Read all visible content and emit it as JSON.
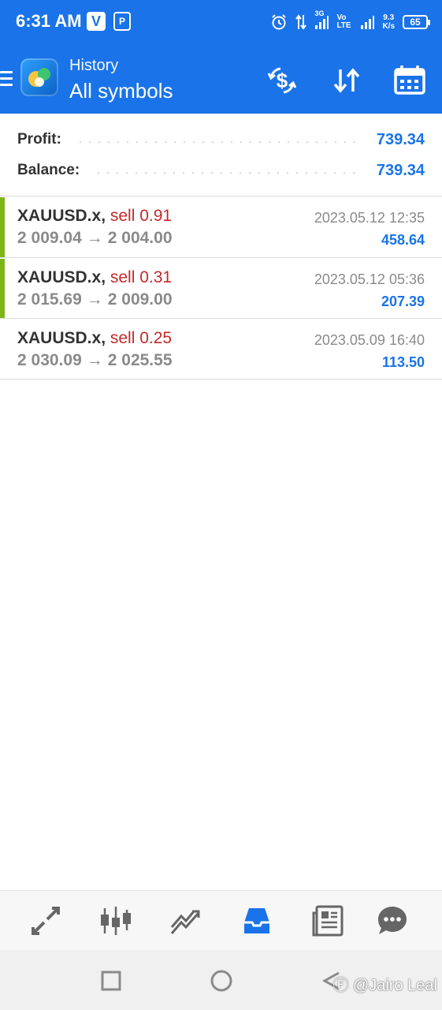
{
  "status_bar": {
    "time": "6:31 AM",
    "net_3g": "3G",
    "volte": "Vo LTE",
    "net_speed_value": "9.3",
    "net_speed_unit": "K/s",
    "battery": "65"
  },
  "app_bar": {
    "title_small": "History",
    "title_big": "All symbols",
    "icons": [
      "menu-icon",
      "metatrader-logo",
      "dollar-refresh-icon",
      "sort-icon",
      "calendar-icon"
    ]
  },
  "summary": {
    "profit_label": "Profit:",
    "profit_value": "739.34",
    "balance_label": "Balance:",
    "balance_value": "739.34"
  },
  "trades": [
    {
      "symbol": "XAUUSD.x,",
      "side": "sell 0.91",
      "open_price": "2 009.04",
      "arrow": "→",
      "close_price": "2 004.00",
      "datetime": "2023.05.12 12:35",
      "profit": "458.64",
      "has_marker": true
    },
    {
      "symbol": "XAUUSD.x,",
      "side": "sell 0.31",
      "open_price": "2 015.69",
      "arrow": "→",
      "close_price": "2 009.00",
      "datetime": "2023.05.12 05:36",
      "profit": "207.39",
      "has_marker": true
    },
    {
      "symbol": "XAUUSD.x,",
      "side": "sell 0.25",
      "open_price": "2 030.09",
      "arrow": "→",
      "close_price": "2 025.55",
      "datetime": "2023.05.09 16:40",
      "profit": "113.50",
      "has_marker": false
    }
  ],
  "bottom_nav": {
    "items": [
      "quotes-icon",
      "chart-candles-icon",
      "trade-icon",
      "history-inbox-icon",
      "news-icon",
      "chat-icon"
    ],
    "active": "history-inbox-icon"
  },
  "system_nav": {
    "watermark": "Ⓕ @Jairo Leal"
  },
  "colors": {
    "accent": "#1a73e8",
    "sell": "#c62828",
    "marker": "#7cb518",
    "muted": "#8a8a8a"
  }
}
